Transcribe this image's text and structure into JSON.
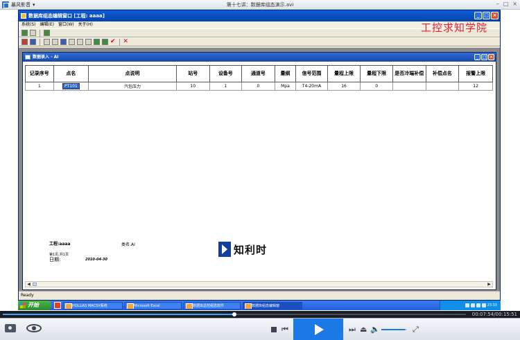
{
  "player": {
    "menu_label": "暴风影音",
    "menu_arrow": "▾",
    "file_title": "第十七讲：数据库组态演示.avi",
    "controls": {
      "prev_glyph": "⏮",
      "next_glyph": "⏭",
      "eject_glyph": "⏏",
      "volume_glyph": "🔈",
      "fullscreen_glyph": "⤢",
      "volume_level": 0.95
    },
    "progress_fraction": 0.5,
    "timecode": "00:07:54/00:15:51"
  },
  "app": {
    "title": "数据库组态编辑窗口 [工程: aaaa]",
    "menus": [
      "系统(S)",
      "编辑(E)",
      "窗口(W)",
      "关于(H)"
    ],
    "watermark": "工控求知学院",
    "status": "Ready"
  },
  "child": {
    "title": "数据录入 - AI",
    "columns": [
      "记录序号",
      "点名",
      "点说明",
      "站号",
      "设备号",
      "通道号",
      "量纲",
      "信号范围",
      "量程上限",
      "量程下限",
      "是否冷端补偿",
      "补偿点名",
      "报警上限"
    ],
    "rows": [
      [
        "1",
        "PT101",
        "汽包压力",
        "10",
        "1",
        "0",
        "Mpa",
        "T4-20mA",
        "16",
        "0",
        "",
        "",
        "12"
      ]
    ]
  },
  "report_footer": {
    "project": "工程:aaaa",
    "category": "类名:AI",
    "small_text": "第1页,共1页",
    "date_label": "日期:",
    "date_value": "2010-04-30"
  },
  "brand_text": "知利时",
  "taskbar": {
    "start_label": "开始",
    "tasks": [
      "HOLLiAS MACSV系统",
      "Microsoft Excel",
      "数据库总控组态软件",
      "数据库组态编辑窗"
    ],
    "clock": "23:33"
  },
  "colors": {
    "title_blue": "#0a5fd8",
    "watermark_red": "#e8202a",
    "selection_blue": "#3168c5",
    "player_accent": "#1c7ae6"
  }
}
